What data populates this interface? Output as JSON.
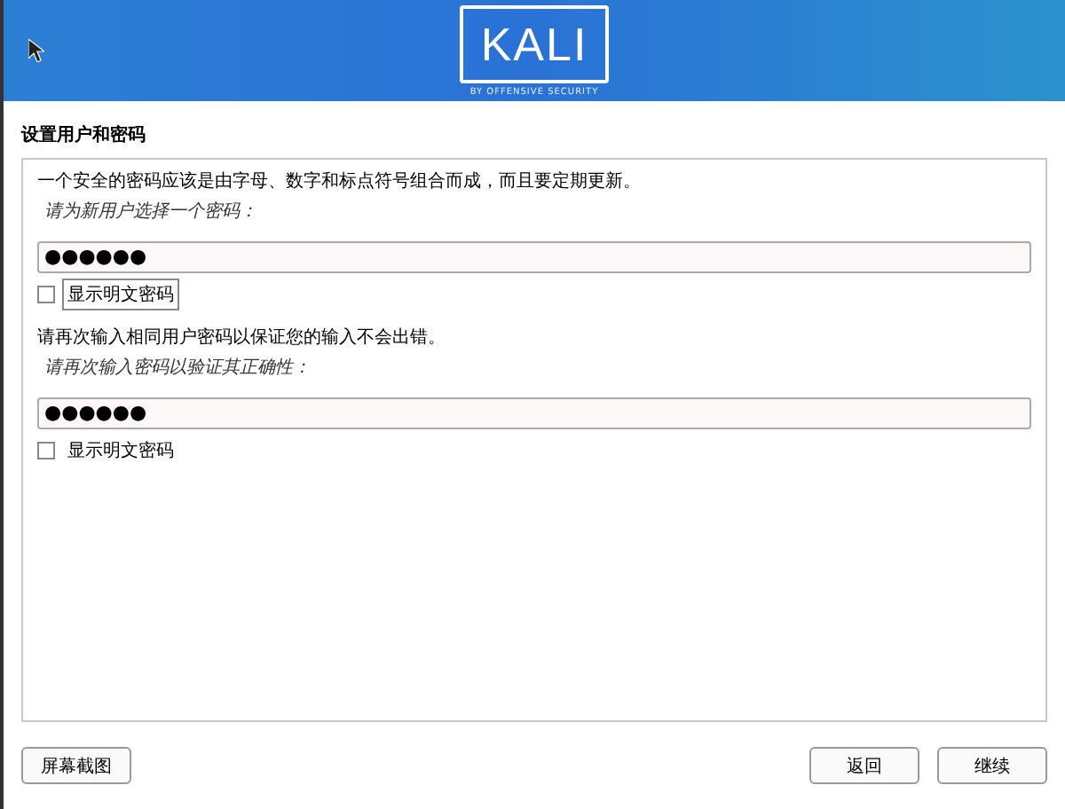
{
  "banner": {
    "logo": "KALI",
    "tagline": "BY OFFENSIVE SECURITY"
  },
  "page_title": "设置用户和密码",
  "sections": [
    {
      "description": "一个安全的密码应该是由字母、数字和标点符号组合而成，而且要定期更新。",
      "prompt": "请为新用户选择一个密码：",
      "value": "●●●●●●",
      "show_password": {
        "label": "显示明文密码",
        "checked": false,
        "focused": true
      }
    },
    {
      "description": "请再次输入相同用户密码以保证您的输入不会出错。",
      "prompt": "请再次输入密码以验证其正确性：",
      "value": "●●●●●●",
      "show_password": {
        "label": "显示明文密码",
        "checked": false,
        "focused": false
      }
    }
  ],
  "buttons": {
    "screenshot": "屏幕截图",
    "back": "返回",
    "continue": "继续"
  }
}
